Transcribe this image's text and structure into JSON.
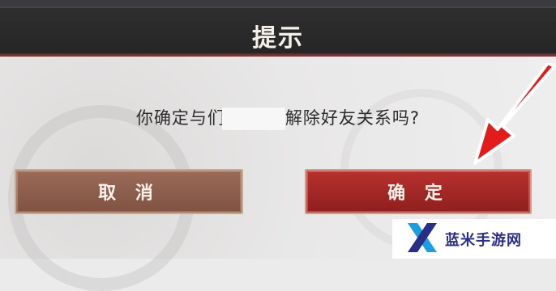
{
  "dialog": {
    "title": "提示",
    "message_before": "你确定与们",
    "message_after": "解除好友关系吗?",
    "cancel_label": "取 消",
    "confirm_label": "确 定"
  },
  "watermark": {
    "text": "蓝米手游网"
  },
  "colors": {
    "header": "#2b2a2b",
    "cancel": "#8b5c4a",
    "confirm": "#a22a27",
    "arrow": "#e31b1b",
    "logo_blue": "#2a2f86",
    "logo_cyan": "#1aa0e0"
  }
}
